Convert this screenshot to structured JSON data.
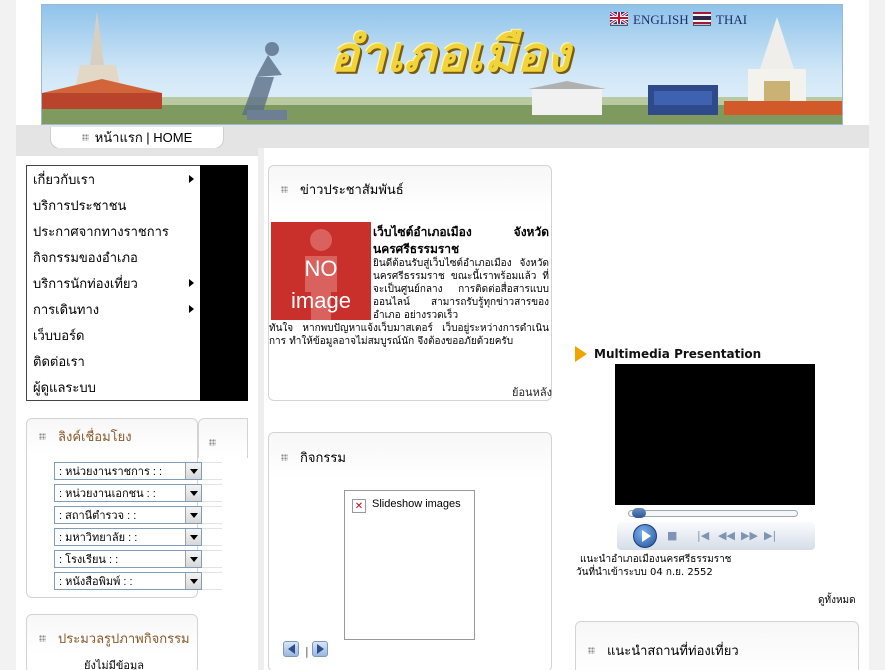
{
  "banner": {
    "title": "อำเภอเมือง",
    "lang_english": "ENGLISH",
    "lang_thai": "THAI"
  },
  "topnav": {
    "home_label": "หน้าแรก | HOME"
  },
  "menu": {
    "items": [
      {
        "label": "เกี่ยวกับเรา",
        "has_submenu": true
      },
      {
        "label": "บริการประชาชน",
        "has_submenu": false
      },
      {
        "label": "ประกาศจากทางราชการ",
        "has_submenu": false
      },
      {
        "label": "กิจกรรมของอำเภอ",
        "has_submenu": false
      },
      {
        "label": "บริการนักท่องเที่ยว",
        "has_submenu": true
      },
      {
        "label": "การเดินทาง",
        "has_submenu": true
      },
      {
        "label": "เว็บบอร์ด",
        "has_submenu": false
      },
      {
        "label": "ติดต่อเรา",
        "has_submenu": false
      },
      {
        "label": "ผู้ดูแลระบบ",
        "has_submenu": false
      }
    ]
  },
  "links": {
    "title": "ลิงค์เชื่อมโยง",
    "selects": [
      ": หน่วยงานราชการ : :",
      ": หน่วยงานเอกชน : :",
      ": สถานีตำรวจ : :",
      ": มหาวิทยาลัย : :",
      ": โรงเรียน : :",
      ": หนังสือพิมพ์ : :"
    ]
  },
  "gallery": {
    "title": "ประมวลรูปภาพกิจกรรม",
    "empty_text": "ยังไม่มีข้อมูล"
  },
  "news": {
    "title": "ข่าวประชาสัมพันธ์",
    "image_text_1": "NO",
    "image_text_2": "image",
    "headline": "เว็บไซต์อำเภอเมือง จังหวัดนครศรีธรรมราช",
    "body_indent": "ยินดีต้อนรับสู่เว็บไซต์อำเภอเมือง จังหวัดนครศรีธรรมราช ขณะนี้เราพร้อมแล้ว ที่จะเป็นศูนย์กลาง การติดต่อสื่อสารแบบออนไลน์ สามารถรับรู้ทุกข่าวสารของอำเภอ อย่างรวดเร็ว",
    "body_rest": "ทันใจ หากพบปัญหาแจ้งเว็บมาสเตอร์ เว็บอยู่ระหว่างการดำเนินการ ทำให้ข้อมูลอาจไม่สมบูรณ์นัก จึงต้องขออภัยด้วยครับ",
    "back_label": "ย้อนหลัง"
  },
  "activity": {
    "title": "กิจกรรม",
    "slideshow_alt": "Slideshow images",
    "nav_separator": "|"
  },
  "multimedia": {
    "title": "Multimedia Presentation",
    "caption_line1": "แนะนำอำเภอเมืองนครศรีธรรมราช",
    "caption_line2": "วันที่นำเข้าระบบ 04 ก.ย. 2552",
    "view_all": "ดูทั้งหมด",
    "progress": 0.0
  },
  "tour": {
    "title": "แนะนำสถานที่ท่องเที่ยว"
  },
  "colors": {
    "menu_bg": "#ffffff",
    "panel_border": "#d3d3d3",
    "accent_orange": "#f0a400",
    "noimage_red": "#c9302c"
  }
}
